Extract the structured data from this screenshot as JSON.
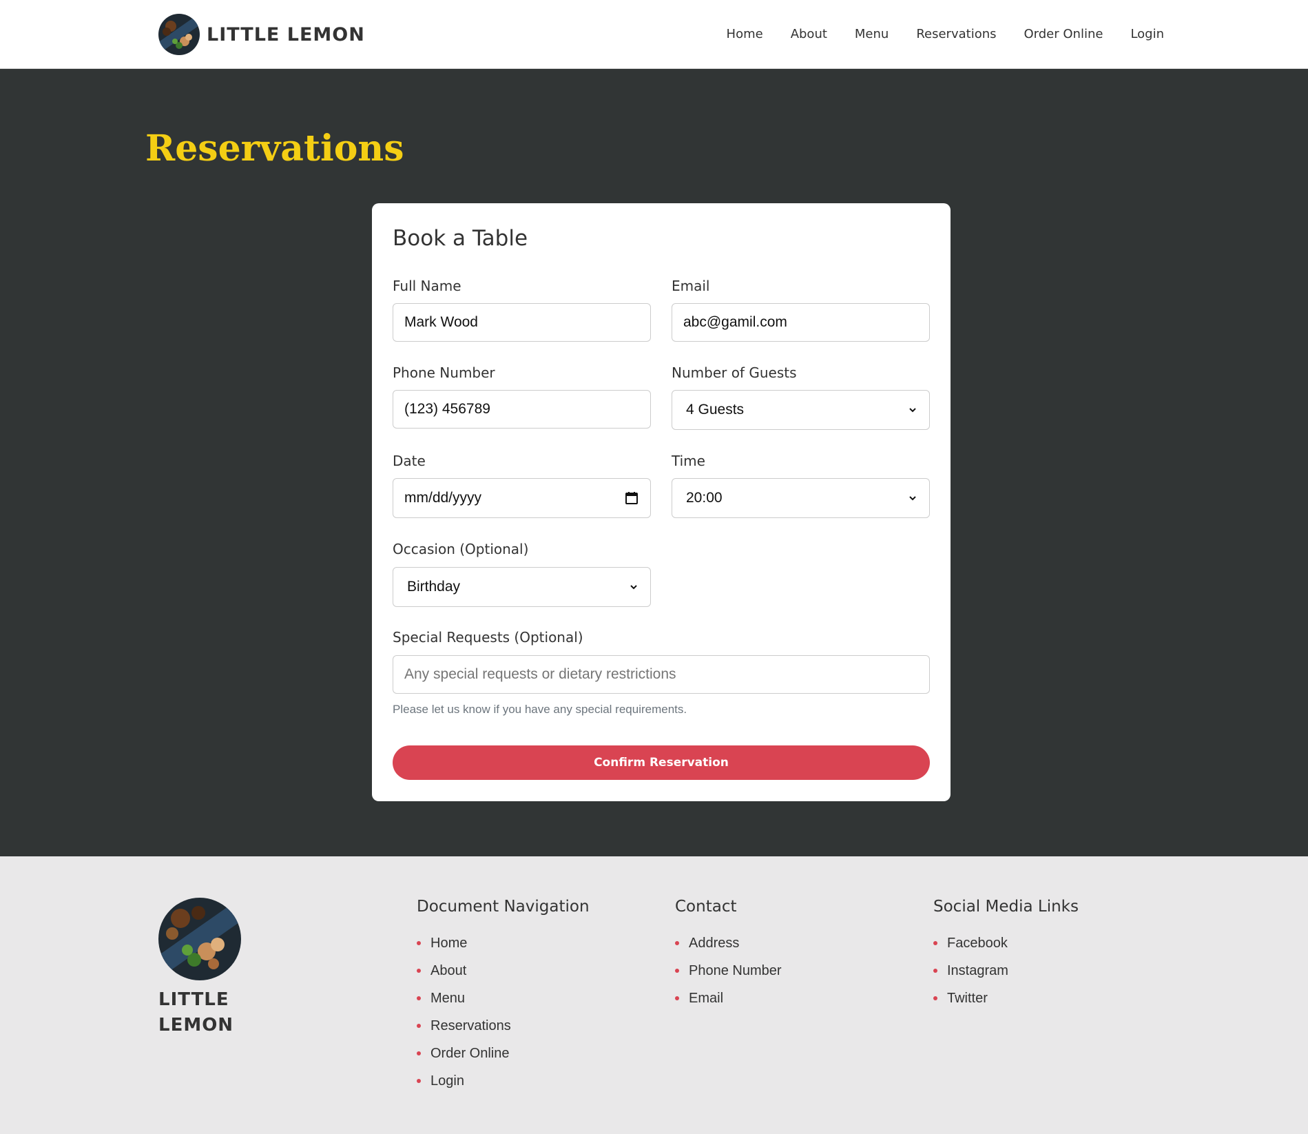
{
  "header": {
    "brand": "LITTLE LEMON",
    "nav": [
      "Home",
      "About",
      "Menu",
      "Reservations",
      "Order Online",
      "Login"
    ]
  },
  "hero": {
    "title": "Reservations"
  },
  "form": {
    "title": "Book a Table",
    "full_name": {
      "label": "Full Name",
      "value": "Mark Wood"
    },
    "email": {
      "label": "Email",
      "value": "abc@gamil.com"
    },
    "phone": {
      "label": "Phone Number",
      "value": "(123) 456789"
    },
    "guests": {
      "label": "Number of Guests",
      "value": "4 Guests"
    },
    "date": {
      "label": "Date",
      "placeholder": "mm/dd/yyyy"
    },
    "time": {
      "label": "Time",
      "value": "20:00"
    },
    "occasion": {
      "label": "Occasion (Optional)",
      "value": "Birthday"
    },
    "requests": {
      "label": "Special Requests (Optional)",
      "placeholder": "Any special requests or dietary restrictions",
      "hint": "Please let us know if you have any special requirements."
    },
    "submit_label": "Confirm Reservation"
  },
  "footer": {
    "brand": "LITTLE LEMON",
    "nav": {
      "heading": "Document Navigation",
      "items": [
        "Home",
        "About",
        "Menu",
        "Reservations",
        "Order Online",
        "Login"
      ]
    },
    "contact": {
      "heading": "Contact",
      "items": [
        "Address",
        "Phone Number",
        "Email"
      ]
    },
    "social": {
      "heading": "Social Media Links",
      "items": [
        "Facebook",
        "Instagram",
        "Twitter"
      ]
    }
  },
  "colors": {
    "primary_dark": "#313535",
    "accent_yellow": "#F4CE14",
    "accent_red": "#D94452",
    "footer_bg": "#E9E8E9"
  }
}
